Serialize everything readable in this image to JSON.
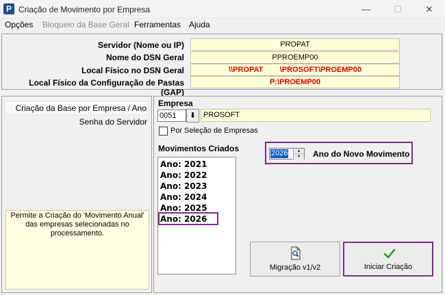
{
  "window": {
    "title": "Criação de Movimento por Empresa",
    "app_icon_letter": "P",
    "minimize": "—",
    "maximize": "☐",
    "close": "✕"
  },
  "menu": {
    "items": [
      "Opções",
      "Bloqueio da Base Geral",
      "Ferramentas",
      "Ajuda"
    ]
  },
  "info": {
    "rows": [
      {
        "label": "Servidor (Nome ou IP)",
        "value": "PROPAT"
      },
      {
        "label": "Nome do DSN Geral",
        "value": "PPROEMP00"
      },
      {
        "label": "Local Físico no DSN Geral",
        "value": "\\\\PROPAT        \\PROSOFT\\PROEMP00"
      },
      {
        "label": "Local Físico da Configuração de Pastas (GAP)",
        "value": "P:\\PROEMP00"
      }
    ]
  },
  "left": {
    "items": [
      "Criação da Base por Empresa / Ano",
      "Senha do Servidor"
    ],
    "help": "Permite a Criação do 'Movimento Anual' das empresas selecionadas no processamento."
  },
  "empresa": {
    "label": "Empresa",
    "code": "0051",
    "lookup_glyph": "⬇",
    "name": "PROSOFT",
    "checkbox_label": "Por Seleção de Empresas"
  },
  "movimentos": {
    "label": "Movimentos Criados",
    "items": [
      "Ano: 2021",
      "Ano: 2022",
      "Ano: 2023",
      "Ano: 2024",
      "Ano: 2025",
      "Ano: 2026"
    ]
  },
  "novo": {
    "year": "2026",
    "label": "Ano do Novo Movimento",
    "up": "▲",
    "down": "▼"
  },
  "buttons": {
    "migracao": "Migração v1/v2",
    "iniciar": "Iniciar Criação"
  },
  "icons": {
    "migracao": "document-search-icon",
    "iniciar": "checkmark-icon"
  },
  "colors": {
    "highlight": "#7a2a8a",
    "yellow_field": "#ffffd7",
    "red_text": "#e00000",
    "check_green": "#1a9a1a"
  }
}
